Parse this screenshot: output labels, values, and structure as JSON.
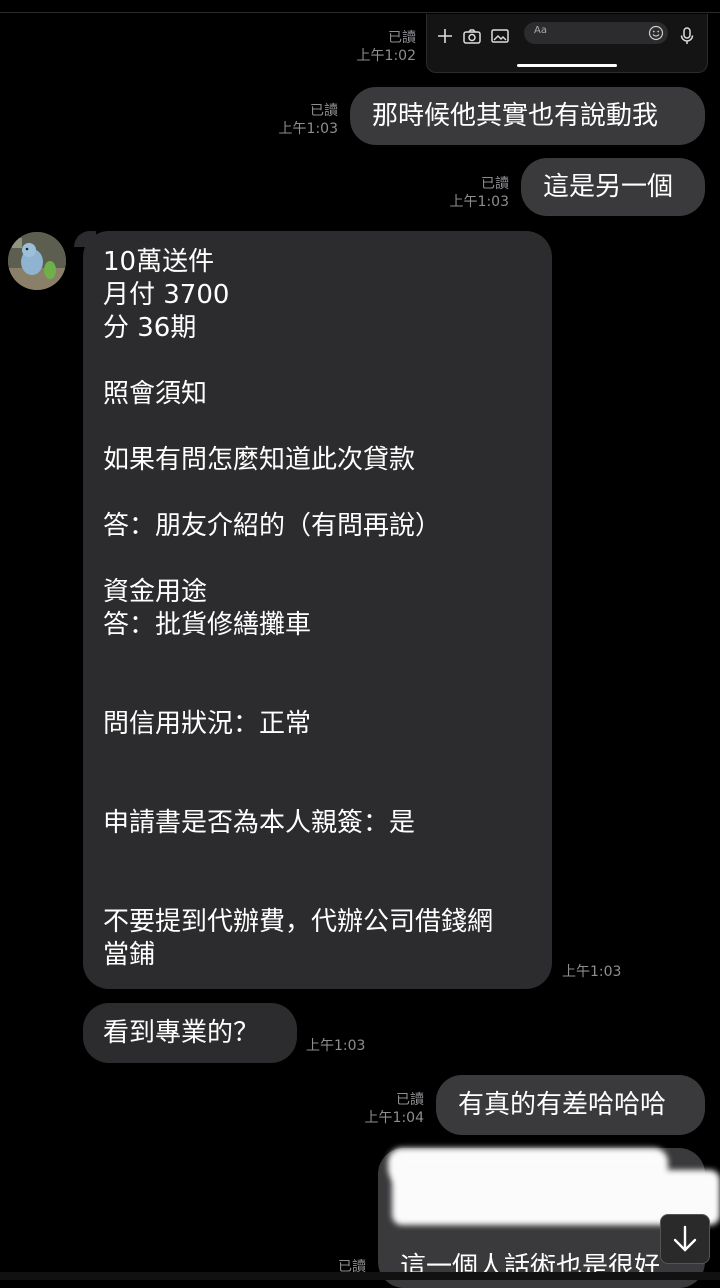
{
  "input_bar": {
    "placeholder": "Aa",
    "icons": [
      "plus-icon",
      "camera-icon",
      "image-icon",
      "smile-icon",
      "microphone-icon"
    ]
  },
  "messages": [
    {
      "side": "out",
      "read": "已讀",
      "time": "上午1:02",
      "text": ""
    },
    {
      "side": "out",
      "read": "已讀",
      "time": "上午1:03",
      "text": "那時候他其實也有說動我"
    },
    {
      "side": "out",
      "read": "已讀",
      "time": "上午1:03",
      "text": "這是另一個"
    },
    {
      "side": "in",
      "time": "上午1:03",
      "lines": [
        "10萬送件",
        "月付 3700",
        "分 36期",
        "",
        "照會須知",
        "",
        "如果有問怎麼知道此次貸款",
        "",
        "答：朋友介紹的（有問再說）",
        "",
        "資金用途",
        "答：批貨修繕攤車",
        "",
        "",
        "問信用狀況：正常",
        "",
        "",
        "申請書是否為本人親簽：是",
        "",
        "",
        "不要提到代辦費，代辦公司借錢網",
        "當鋪"
      ]
    },
    {
      "side": "in",
      "time": "上午1:03",
      "text": "看到專業的？"
    },
    {
      "side": "out",
      "read": "已讀",
      "time": "上午1:04",
      "text": "有真的有差哈哈哈"
    },
    {
      "side": "out",
      "read": "已讀",
      "time": "",
      "text": "這一個人話術也是很好"
    }
  ],
  "colors": {
    "background": "#000000",
    "bubble_out": "#3a3a3c",
    "bubble_in": "#2c2c2e",
    "meta_text": "#8e8e93"
  }
}
